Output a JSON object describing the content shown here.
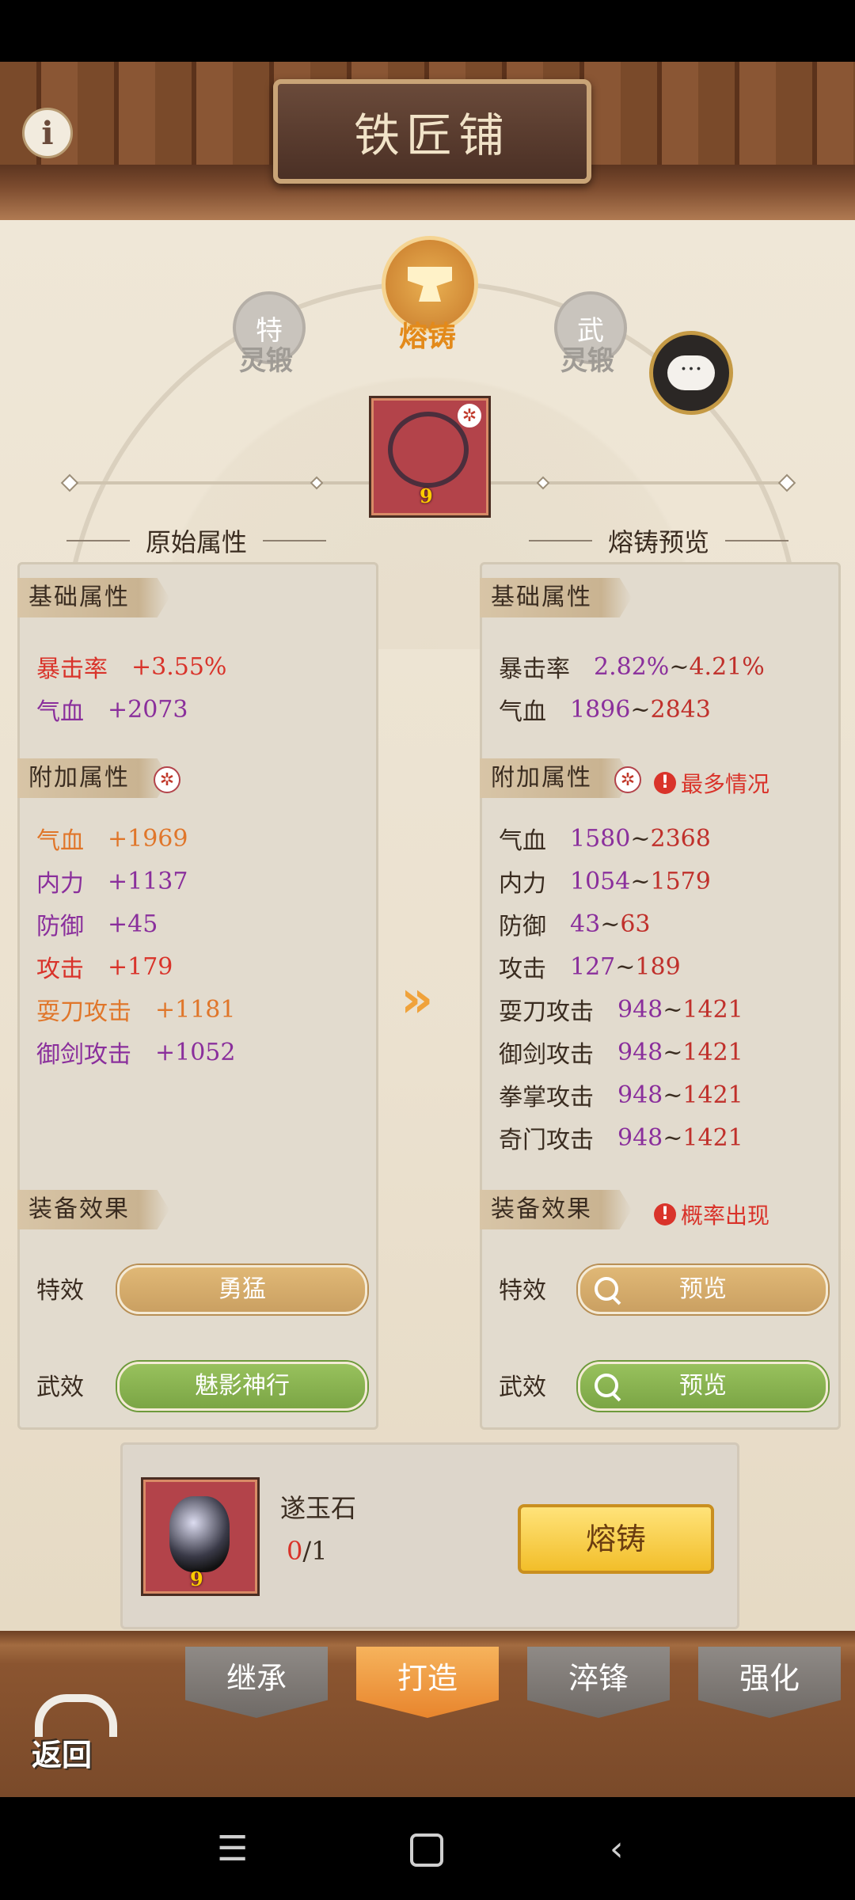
{
  "header": {
    "title": "铁匠铺"
  },
  "modes": {
    "special": {
      "badge": "特",
      "label": "灵锻"
    },
    "fuse": {
      "label": "熔铸"
    },
    "martial": {
      "badge": "武",
      "label": "灵锻"
    }
  },
  "item": {
    "level": "9"
  },
  "left": {
    "heading": "原始属性",
    "base_tag": "基础属性",
    "base_stats": [
      {
        "name": "暴击率",
        "value": "+3.55%"
      },
      {
        "name": "气血",
        "value": "+2073"
      }
    ],
    "extra_tag": "附加属性",
    "extra_stats": [
      {
        "name": "气血",
        "value": "+1969"
      },
      {
        "name": "内力",
        "value": "+1137"
      },
      {
        "name": "防御",
        "value": "+45"
      },
      {
        "name": "攻击",
        "value": "+179"
      },
      {
        "name": "耍刀攻击",
        "value": "+1181"
      },
      {
        "name": "御剑攻击",
        "value": "+1052"
      }
    ],
    "effects_tag": "装备效果",
    "special_effect": {
      "label": "特效",
      "value": "勇猛"
    },
    "martial_effect": {
      "label": "武效",
      "value": "魅影神行"
    }
  },
  "right": {
    "heading": "熔铸预览",
    "base_tag": "基础属性",
    "base_stats": [
      {
        "name": "暴击率",
        "min": "2.82%",
        "sep": "~",
        "max": "4.21%"
      },
      {
        "name": "气血",
        "min": "1896",
        "sep": "~",
        "max": "2843"
      }
    ],
    "extra_tag": "附加属性",
    "extra_note": "最多情况",
    "extra_stats": [
      {
        "name": "气血",
        "min": "1580",
        "sep": "~",
        "max": "2368"
      },
      {
        "name": "内力",
        "min": "1054",
        "sep": "~",
        "max": "1579"
      },
      {
        "name": "防御",
        "min": "43",
        "sep": "~",
        "max": "63"
      },
      {
        "name": "攻击",
        "min": "127",
        "sep": "~",
        "max": "189"
      },
      {
        "name": "耍刀攻击",
        "min": "948",
        "sep": "~",
        "max": "1421"
      },
      {
        "name": "御剑攻击",
        "min": "948",
        "sep": "~",
        "max": "1421"
      },
      {
        "name": "拳掌攻击",
        "min": "948",
        "sep": "~",
        "max": "1421"
      },
      {
        "name": "奇门攻击",
        "min": "948",
        "sep": "~",
        "max": "1421"
      }
    ],
    "effects_tag": "装备效果",
    "effects_note": "概率出现",
    "special_effect": {
      "label": "特效",
      "value": "预览"
    },
    "martial_effect": {
      "label": "武效",
      "value": "预览"
    }
  },
  "material": {
    "name": "遂玉石",
    "have": "0",
    "need": "/1",
    "level": "9",
    "action": "熔铸"
  },
  "tabs": [
    "继承",
    "打造",
    "淬锋",
    "强化"
  ],
  "back_label": "返回",
  "colors": {
    "accent_orange": "#e38a1a",
    "stat_red": "#d9332a",
    "stat_purple": "#8a2f9c",
    "button_gold": "#f2be2a",
    "effect_green": "#7ba545"
  },
  "icons": {
    "info": "info-icon",
    "chat": "chat-icon",
    "search": "search-icon",
    "back": "back-arrow-icon"
  }
}
